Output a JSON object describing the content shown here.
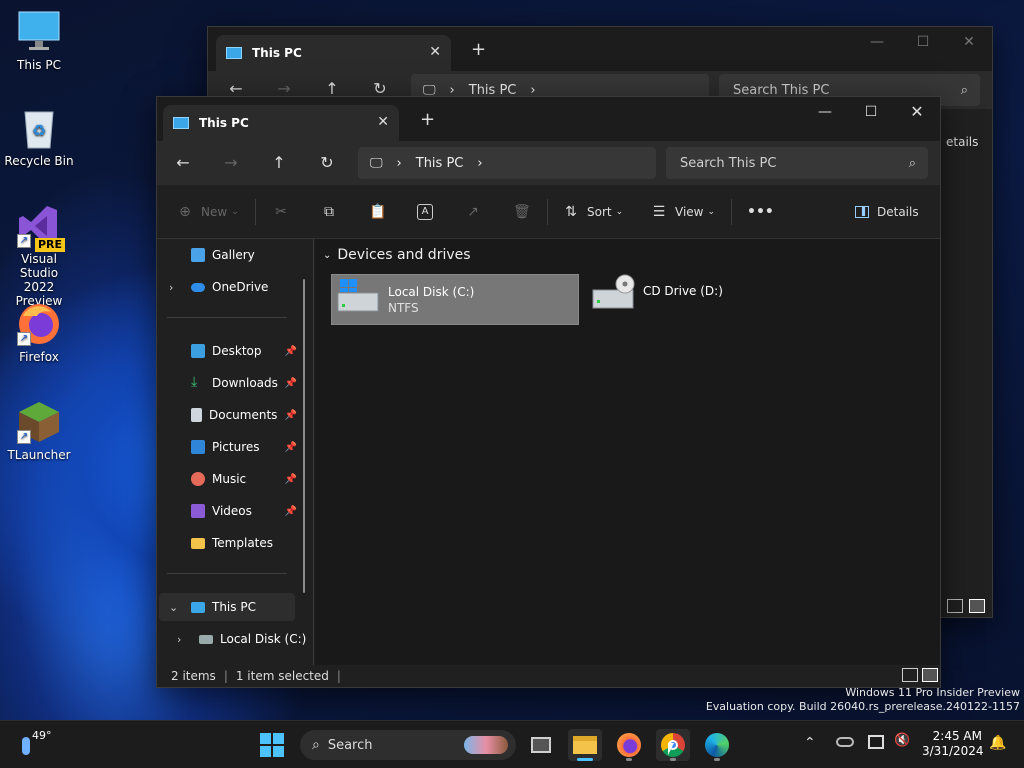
{
  "desktop": {
    "icons": [
      {
        "label": "This PC",
        "icon": "monitor-icon"
      },
      {
        "label": "Recycle Bin",
        "icon": "recycle-bin-icon"
      },
      {
        "label": "Visual Studio\n2022 Preview",
        "icon": "visual-studio-icon",
        "badge": "PRE"
      },
      {
        "label": "Firefox",
        "icon": "firefox-icon"
      },
      {
        "label": "TLauncher",
        "icon": "tlauncher-icon"
      }
    ]
  },
  "back_window": {
    "tab_title": "This PC",
    "address_crumb": "This PC",
    "search_placeholder": "Search This PC",
    "details_partial": "etails"
  },
  "window": {
    "tab_title": "This PC",
    "address_crumb": "This PC",
    "search_placeholder": "Search This PC",
    "toolbar": {
      "new_label": "New",
      "sort_label": "Sort",
      "view_label": "View",
      "more_label": "•••",
      "details_label": "Details"
    },
    "nav_pane": {
      "top_items": [
        {
          "label": "Gallery",
          "icon": "gallery-icon"
        },
        {
          "label": "OneDrive",
          "icon": "onedrive-icon"
        }
      ],
      "quick_access": [
        {
          "label": "Desktop",
          "icon": "desktop-folder-icon",
          "pinned": true
        },
        {
          "label": "Downloads",
          "icon": "downloads-icon",
          "pinned": true
        },
        {
          "label": "Documents",
          "icon": "documents-icon",
          "pinned": true
        },
        {
          "label": "Pictures",
          "icon": "pictures-icon",
          "pinned": true
        },
        {
          "label": "Music",
          "icon": "music-icon",
          "pinned": true
        },
        {
          "label": "Videos",
          "icon": "videos-icon",
          "pinned": true
        },
        {
          "label": "Templates",
          "icon": "folder-icon",
          "pinned": false
        }
      ],
      "tree": [
        {
          "label": "This PC",
          "icon": "monitor-icon"
        },
        {
          "label": "Local Disk (C:)",
          "icon": "drive-icon"
        }
      ]
    },
    "section_header": "Devices and drives",
    "drives": [
      {
        "name": "Local Disk (C:)",
        "subtitle": "NTFS",
        "selected": true,
        "icon": "windows-drive-icon"
      },
      {
        "name": "CD Drive (D:)",
        "subtitle": "",
        "selected": false,
        "icon": "cd-drive-icon"
      }
    ],
    "status": {
      "count": "2 items",
      "selected": "1 item selected"
    }
  },
  "watermark": {
    "line1": "Windows 11 Pro Insider Preview",
    "line2": "Evaluation copy. Build 26040.rs_prerelease.240122-1157"
  },
  "taskbar": {
    "weather_temp": "49°",
    "search_label": "Search",
    "time": "2:45 AM",
    "date": "3/31/2024"
  },
  "colors": {
    "accent": "#3ba7e8",
    "selection": "#777777",
    "window_bg": "#202020"
  }
}
